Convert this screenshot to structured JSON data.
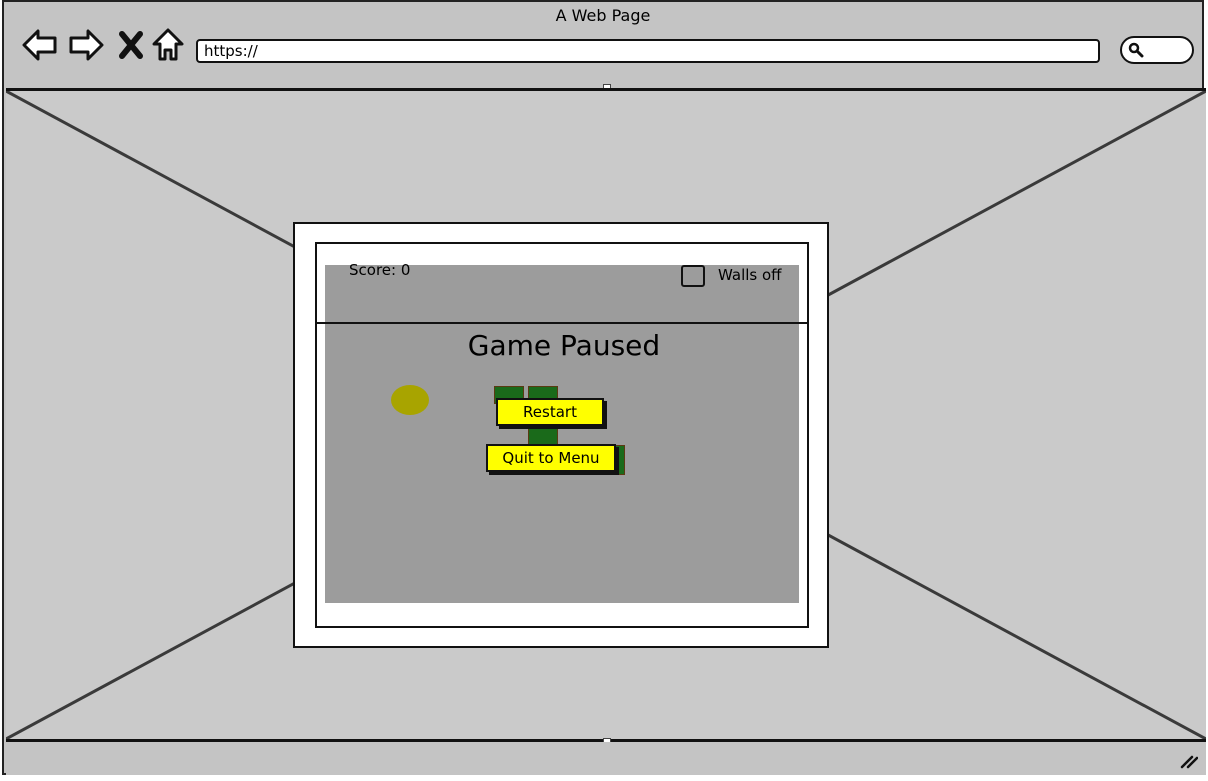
{
  "window": {
    "title": "A Web Page"
  },
  "toolbar": {
    "url": "https://",
    "icons": [
      "back-arrow-icon",
      "forward-arrow-icon",
      "close-x-icon",
      "home-icon",
      "search-icon"
    ]
  },
  "game": {
    "score_label": "Score: 0",
    "walls_label": "Walls off",
    "walls_checked": false,
    "paused_title": "Game Paused",
    "restart_label": "Restart",
    "quit_label": "Quit to Menu"
  },
  "colors": {
    "play_area": "#9c9c9c",
    "button_fill": "#ffff00",
    "snake": "#1a6a1a",
    "food": "#a8a400"
  }
}
